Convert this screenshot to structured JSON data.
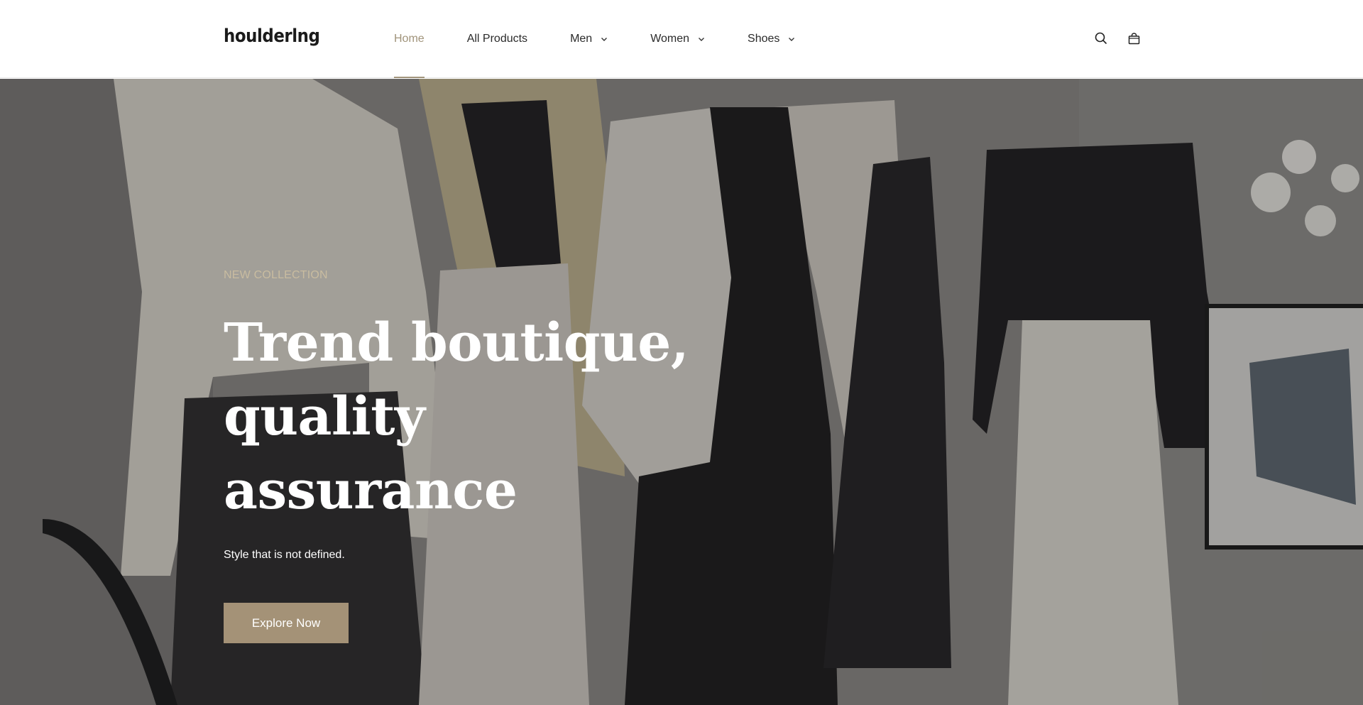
{
  "brand": {
    "logo_text": "houlderlng",
    "accent_color": "#a49277"
  },
  "nav": {
    "items": [
      {
        "label": "Home",
        "active": true,
        "dropdown": false
      },
      {
        "label": "All Products",
        "active": false,
        "dropdown": false
      },
      {
        "label": "Men",
        "active": false,
        "dropdown": true
      },
      {
        "label": "Women",
        "active": false,
        "dropdown": true
      },
      {
        "label": "Shoes",
        "active": false,
        "dropdown": true
      }
    ]
  },
  "header_icons": {
    "search": "search-icon",
    "cart": "shopping-bag-icon"
  },
  "hero": {
    "eyebrow": "NEW COLLECTION",
    "title_line1": "Trend boutique,",
    "title_line2": "quality assurance",
    "subtitle": "Style that is not defined.",
    "cta_label": "Explore Now",
    "image": "mannequins-boutique-display"
  }
}
